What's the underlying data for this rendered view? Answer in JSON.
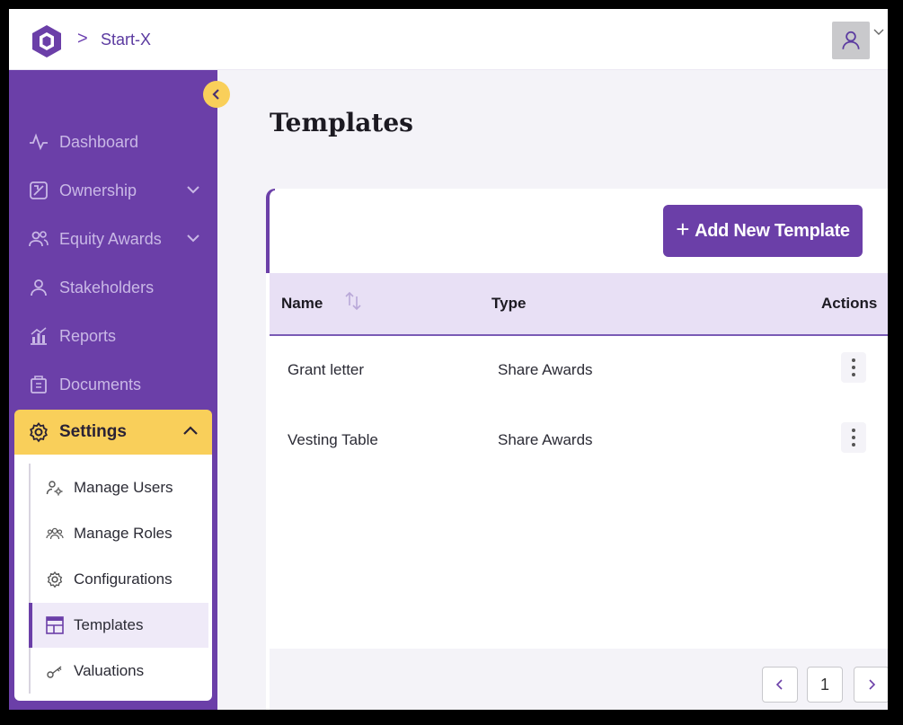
{
  "header": {
    "breadcrumb": "Start-X",
    "breadcrumb_separator": ">"
  },
  "sidebar": {
    "items": [
      {
        "label": "Dashboard",
        "icon": "activity-icon"
      },
      {
        "label": "Ownership",
        "icon": "ownership-icon",
        "has_children": true
      },
      {
        "label": "Equity Awards",
        "icon": "users-icon",
        "has_children": true
      },
      {
        "label": "Stakeholders",
        "icon": "person-icon"
      },
      {
        "label": "Reports",
        "icon": "chart-icon"
      },
      {
        "label": "Documents",
        "icon": "documents-icon"
      }
    ],
    "settings": {
      "label": "Settings",
      "expanded": true,
      "children": [
        {
          "label": "Manage Users",
          "icon": "user-gear-icon"
        },
        {
          "label": "Manage Roles",
          "icon": "group-icon"
        },
        {
          "label": "Configurations",
          "icon": "gear-icon"
        },
        {
          "label": "Templates",
          "icon": "template-icon",
          "active": true
        },
        {
          "label": "Valuations",
          "icon": "key-icon"
        }
      ]
    }
  },
  "main": {
    "title": "Templates",
    "add_button_label": "Add New Template",
    "table": {
      "columns": [
        "Name",
        "Type",
        "Actions"
      ],
      "rows": [
        {
          "name": "Grant letter",
          "type": "Share Awards"
        },
        {
          "name": "Vesting Table",
          "type": "Share Awards"
        }
      ]
    },
    "pagination": {
      "prev": "<",
      "current": "1",
      "next": ">"
    }
  },
  "colors": {
    "brand": "#6b3fa8",
    "accent": "#f9cf5a",
    "header_row": "#e8e0f5"
  }
}
